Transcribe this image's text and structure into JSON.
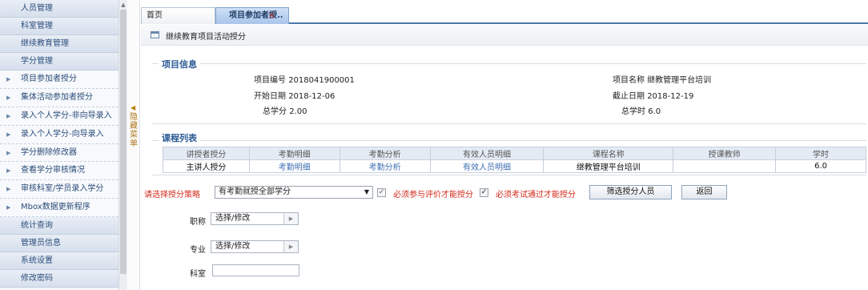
{
  "sidebar": {
    "items": [
      {
        "label": "人员管理",
        "type": "group"
      },
      {
        "label": "科室管理",
        "type": "group"
      },
      {
        "label": "继续教育管理",
        "type": "group"
      },
      {
        "label": "学分管理",
        "type": "group"
      },
      {
        "label": "项目参加者授分",
        "type": "item"
      },
      {
        "label": "集体活动参加者授分",
        "type": "item"
      },
      {
        "label": "录入个人学分-非向导录入",
        "type": "item"
      },
      {
        "label": "录入个人学分-向导录入",
        "type": "item"
      },
      {
        "label": "学分删除修改器",
        "type": "item"
      },
      {
        "label": "查看学分审核情况",
        "type": "item"
      },
      {
        "label": "审核科室/学员录入学分",
        "type": "item"
      },
      {
        "label": "Mbox数据更新程序",
        "type": "item"
      },
      {
        "label": "统计查询",
        "type": "group"
      },
      {
        "label": "管理员信息",
        "type": "group"
      },
      {
        "label": "系统设置",
        "type": "group"
      },
      {
        "label": "修改密码",
        "type": "group"
      }
    ],
    "toggle_label": "隐藏菜单"
  },
  "tabs": [
    {
      "label": "首页"
    },
    {
      "label": "项目参加者授..",
      "active": true
    }
  ],
  "page_title": "继续教育项目活动授分",
  "project_info": {
    "legend": "项目信息",
    "fields": [
      {
        "key": "项目编号",
        "value": "2018041900001"
      },
      {
        "key": "项目名称",
        "value": "继教管理平台培训"
      },
      {
        "key": "开始日期",
        "value": "2018-12-06"
      },
      {
        "key": "截止日期",
        "value": "2018-12-19"
      },
      {
        "key": "总学分",
        "value": "2.00"
      },
      {
        "key": "总学时",
        "value": "6.0"
      }
    ]
  },
  "course_list": {
    "legend": "课程列表",
    "columns": [
      "讲授者授分",
      "考勤明细",
      "考勤分析",
      "有效人员明细",
      "课程名称",
      "授课教师",
      "学时"
    ],
    "rows": [
      [
        "主讲人授分",
        "考勤明细",
        "考勤分析",
        "有效人员明细",
        "继教管理平台培训",
        "",
        "6.0"
      ]
    ]
  },
  "controls": {
    "strategy_label": "请选择授分策略",
    "strategy_value": "有考勤就授全部学分",
    "eval_required_label": "必须参与评价才能授分",
    "exam_required_label": "必须考试通过才能授分",
    "filter_button": "筛选授分人员",
    "back_button": "返回",
    "title_label": "职称",
    "major_label": "专业",
    "dept_label": "科室",
    "picker_text": "选择/修改"
  },
  "colors": {
    "legend": "#2c5a96",
    "warning": "#d22a1a",
    "link": "#3f6fb4"
  }
}
